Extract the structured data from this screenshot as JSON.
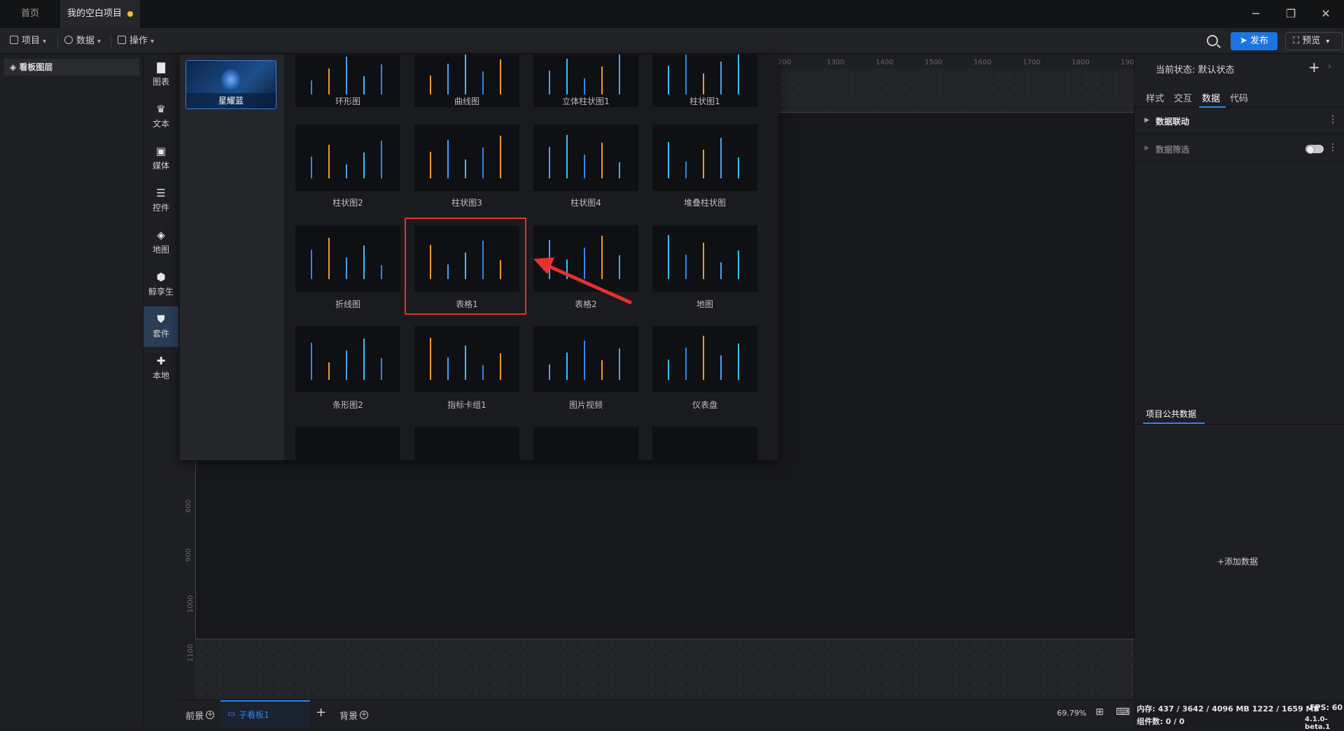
{
  "tabs": {
    "home": "首页",
    "project": "我的空白项目"
  },
  "window": {
    "minimize": "─",
    "restore": "❐",
    "close": "✕"
  },
  "toolbar": {
    "project": "项目",
    "data": "数据",
    "operate": "操作",
    "publish": "发布",
    "preview": "预览"
  },
  "layers": {
    "title": "看板图层"
  },
  "rail": [
    "图表",
    "文本",
    "媒体",
    "控件",
    "地图",
    "鲸孪生",
    "套件",
    "本地"
  ],
  "rail_icons": [
    "bar-chart-icon",
    "crown-icon",
    "media-icon",
    "widget-icon",
    "map-icon",
    "cube-icon",
    "shirt-icon",
    "puzzle-icon"
  ],
  "ruler": {
    "top": [
      "200",
      "1300",
      "1400",
      "1500",
      "1600",
      "1700",
      "1800",
      "1900"
    ],
    "left": [
      "800",
      "900",
      "1000",
      "1100"
    ]
  },
  "theme": {
    "name": "星耀蓝"
  },
  "kits": {
    "row0": [
      "环形图",
      "曲线图",
      "立体柱状图1",
      "柱状图1"
    ],
    "row1": [
      "柱状图2",
      "柱状图3",
      "柱状图4",
      "堆叠柱状图"
    ],
    "row2": [
      "折线图",
      "表格1",
      "表格2",
      "地图"
    ],
    "row3": [
      "条形图2",
      "指标卡组1",
      "图片视频",
      "仪表盘"
    ]
  },
  "right_panel": {
    "state_label": "当前状态: 默认状态",
    "tabs": [
      "样式",
      "交互",
      "数据",
      "代码"
    ],
    "rows": [
      "数据联动",
      "数据筛选"
    ],
    "public_data": "项目公共数据",
    "add_data": "+添加数据"
  },
  "bottom": {
    "foreground": "前景",
    "board": "子看板1",
    "background": "背景",
    "zoom": "69.79%"
  },
  "stats": {
    "memory": "内存: 437 / 3642 / 4096 MB  1222 / 1659 MB",
    "fps": "FPS: 60",
    "components": "组件数: 0 / 0",
    "version": "4.1.0-beta.1"
  },
  "colors": {
    "accent": "#1c74e0",
    "selection": "#e5322d",
    "unsaved_dot": "#f5b93e"
  }
}
